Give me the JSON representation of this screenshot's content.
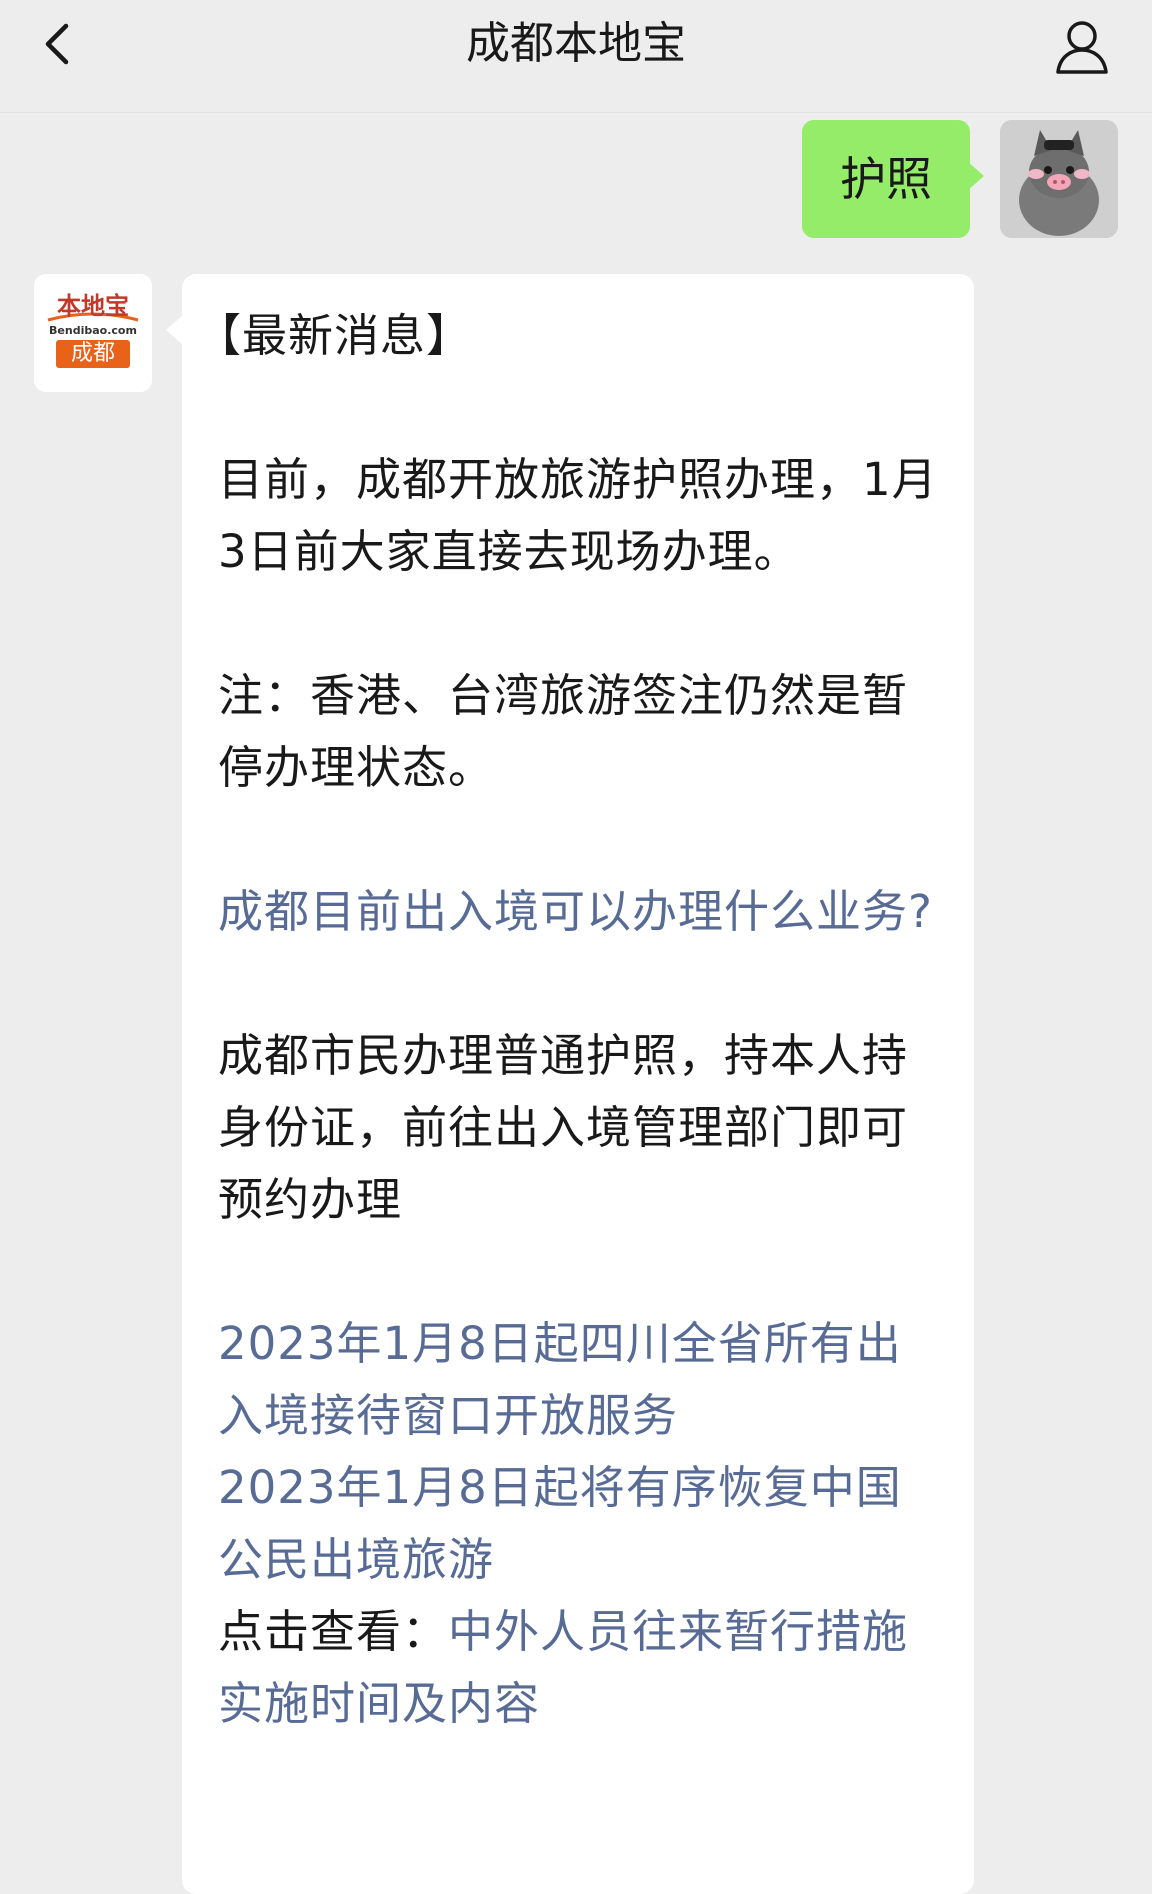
{
  "header": {
    "title": "成都本地宝"
  },
  "icons": {
    "back": "chevron-left-icon",
    "profile": "person-icon"
  },
  "outgoing": {
    "text": "护照"
  },
  "bot": {
    "logo_top": "本地宝",
    "logo_domain": "Bendibao.com",
    "logo_city": "成都"
  },
  "message": {
    "heading": "【最新消息】",
    "p1": "目前，成都开放旅游护照办理，1月3日前大家直接去现场办理。",
    "p2": "注：香港、台湾旅游签注仍然是暂停办理状态。",
    "link1": "成都目前出入境可以办理什么业务?",
    "p3": "成都市民办理普通护照，持本人持身份证，前往出入境管理部门即可预约办理",
    "link2": "2023年1月8日起四川全省所有出入境接待窗口开放服务",
    "link3": "2023年1月8日起将有序恢复中国公民出境旅游",
    "click_label": "点击查看：",
    "link4": "中外人员往来暂行措施实施时间及内容"
  },
  "colors": {
    "background": "#ededed",
    "bubble_out": "#95ec69",
    "link": "#576b95",
    "logo_orange": "#e8621a"
  }
}
